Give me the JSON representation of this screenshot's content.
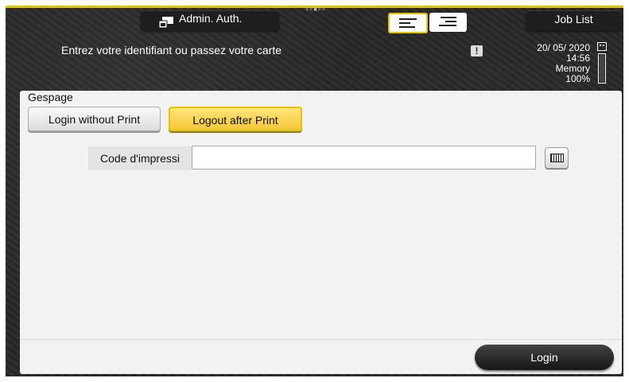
{
  "header": {
    "admin_auth_label": "Admin. Auth.",
    "job_list_label": "Job List",
    "grip": "<<■>>"
  },
  "status": {
    "message": "Entrez votre identifiant ou passez votre carte",
    "warning_symbol": "!",
    "date": "20/ 05/ 2020",
    "time": "14:56",
    "memory_label": "Memory",
    "memory_percent": "100%",
    "memory_level": 1.0
  },
  "panel": {
    "title": "Gespage",
    "tabs": [
      {
        "label": "Login without Print",
        "selected": false
      },
      {
        "label": "Logout after Print",
        "selected": true
      }
    ],
    "code_field": {
      "label": "Code d'impressi",
      "value": "",
      "placeholder": ""
    },
    "login_label": "Login"
  },
  "colors": {
    "accent": "#e2c400",
    "selected_tab": "#f4c63a",
    "background": "#2a2a2a",
    "panel": "#f2f2f2"
  },
  "icons": [
    "admin-auth-icon",
    "list-view-icon",
    "detail-view-icon",
    "warning-icon",
    "paper-tray-icon",
    "keyboard-icon"
  ]
}
